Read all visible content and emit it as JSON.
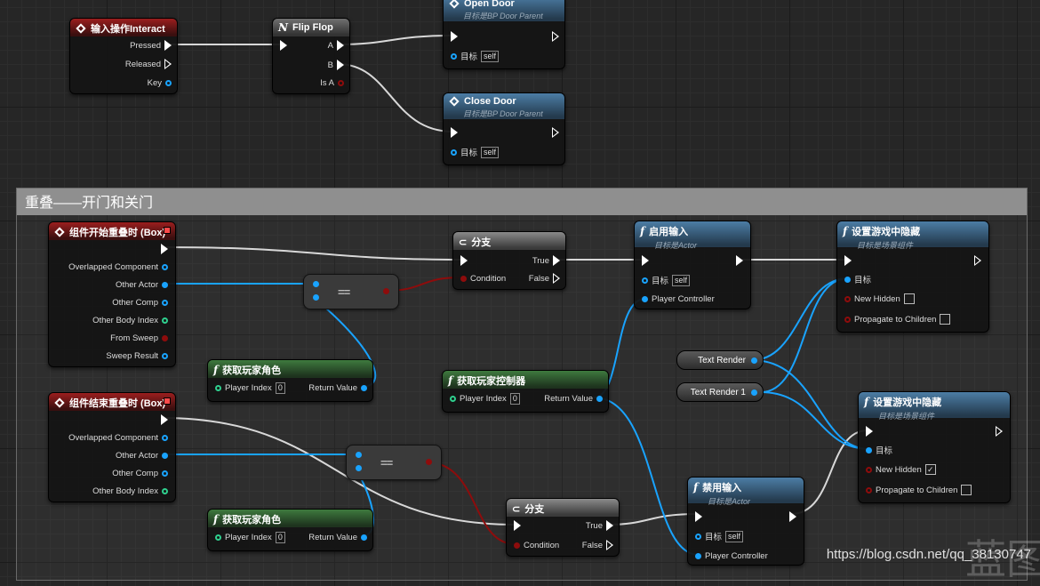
{
  "comment": {
    "title": "重叠——开门和关门"
  },
  "nodes": {
    "interact": {
      "title": "输入操作Interact",
      "pins": [
        "Pressed",
        "Released",
        "Key"
      ]
    },
    "flipflop": {
      "title": "Flip Flop",
      "pins": [
        "A",
        "B",
        "Is A"
      ]
    },
    "open_door": {
      "title": "Open Door",
      "subtitle": "目标是BP Door Parent",
      "target_label": "目标",
      "target_value": "self"
    },
    "close_door": {
      "title": "Close Door",
      "subtitle": "目标是BP Door Parent",
      "target_label": "目标",
      "target_value": "self"
    },
    "begin_overlap": {
      "title": "组件开始重叠时 (Box)",
      "pins": [
        "Overlapped Component",
        "Other Actor",
        "Other Comp",
        "Other Body Index",
        "From Sweep",
        "Sweep Result"
      ]
    },
    "end_overlap": {
      "title": "组件结束重叠时 (Box)",
      "pins": [
        "Overlapped Component",
        "Other Actor",
        "Other Comp",
        "Other Body Index"
      ]
    },
    "eq1": {
      "label": "=="
    },
    "eq2": {
      "label": "=="
    },
    "branch1": {
      "title": "分支",
      "condition": "Condition",
      "true_label": "True",
      "false_label": "False"
    },
    "branch2": {
      "title": "分支",
      "condition": "Condition",
      "true_label": "True",
      "false_label": "False"
    },
    "get_char1": {
      "title": "获取玩家角色",
      "in_label": "Player Index",
      "in_value": "0",
      "out_label": "Return Value"
    },
    "get_char2": {
      "title": "获取玩家角色",
      "in_label": "Player Index",
      "in_value": "0",
      "out_label": "Return Value"
    },
    "get_ctrl": {
      "title": "获取玩家控制器",
      "in_label": "Player Index",
      "in_value": "0",
      "out_label": "Return Value"
    },
    "enable_input": {
      "title": "启用输入",
      "subtitle": "目标是Actor",
      "target_label": "目标",
      "target_value": "self",
      "pc_label": "Player Controller"
    },
    "disable_input": {
      "title": "禁用输入",
      "subtitle": "目标是Actor",
      "target_label": "目标",
      "target_value": "self",
      "pc_label": "Player Controller"
    },
    "hide1": {
      "title": "设置游戏中隐藏",
      "subtitle": "目标是场景组件",
      "target_label": "目标",
      "hidden_label": "New Hidden",
      "hidden_checked": false,
      "prop_label": "Propagate to Children",
      "prop_checked": false
    },
    "hide2": {
      "title": "设置游戏中隐藏",
      "subtitle": "目标是场景组件",
      "target_label": "目标",
      "hidden_label": "New Hidden",
      "hidden_checked": true,
      "prop_label": "Propagate to Children",
      "prop_checked": false
    },
    "text_render": {
      "label": "Text Render"
    },
    "text_render1": {
      "label": "Text Render 1"
    }
  },
  "watermark": "https://blog.csdn.net/qq_38130747",
  "background_mark": "蓝图",
  "colors": {
    "exec": "#ffffff",
    "object": "#19a3ff",
    "bool": "#8e0c0c",
    "int": "#2fcf8e",
    "event_header": "#9b1e1e",
    "function_header": "#4c7da5",
    "pure_header": "#3e7a3e"
  }
}
